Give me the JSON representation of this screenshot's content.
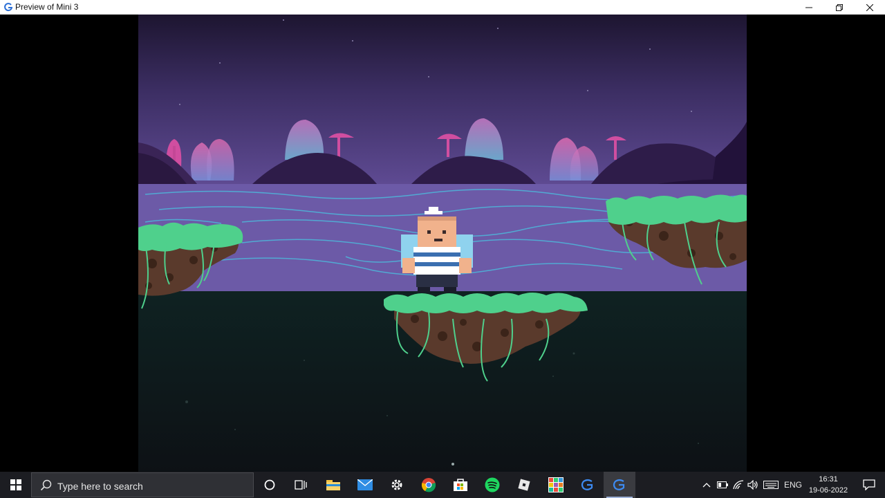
{
  "window": {
    "title": "Preview of Mini 3",
    "controls": {
      "minimize_icon": "minimize-icon",
      "maximize_icon": "restore-icon",
      "close_icon": "close-icon"
    }
  },
  "game": {
    "scene": "night-swamp-platformer",
    "colors": {
      "sky_top": "#1f1730",
      "sky_mid": "#4a3a78",
      "water": "#6e5aa8",
      "ground": "#0c1a1a",
      "grass": "#4fd08c",
      "dirt": "#5a3a2c"
    }
  },
  "taskbar": {
    "search_placeholder": "Type here to search",
    "pinned": [
      "cortana-icon",
      "task-view-icon",
      "file-explorer-icon",
      "mail-icon",
      "settings-icon",
      "chrome-icon",
      "store-icon",
      "spotify-icon",
      "roblox-icon",
      "grid-app-icon",
      "gdevelop-icon",
      "gdevelop-preview-icon"
    ],
    "tray": {
      "language": "ENG"
    },
    "clock": {
      "time": "16:31",
      "date": "19-06-2022"
    }
  }
}
